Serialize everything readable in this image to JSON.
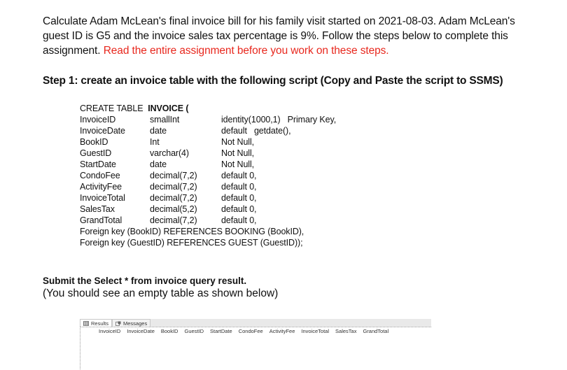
{
  "intro": {
    "line1": "Calculate Adam McLean's final invoice bill for his family visit started on 2021-08-03. Adam McLean's",
    "line2": "guest ID is G5 and the invoice sales tax percentage is 9%. Follow the steps below to complete this",
    "line3_plain": "assignment. ",
    "line3_red": "Read the entire assignment before you work on these steps."
  },
  "step1": "Step 1: create an invoice table with the following script (Copy and Paste the script to SSMS)",
  "script": {
    "header_plain": "CREATE TABLE ",
    "header_bold": "INVOICE (",
    "columns": [
      {
        "name": "InvoiceID",
        "type": "smallInt",
        "constraint": "identity(1000,1)   Primary Key,"
      },
      {
        "name": "InvoiceDate",
        "type": "date",
        "constraint": "default   getdate(),"
      },
      {
        "name": "BookID",
        "type": "Int",
        "constraint": "Not Null,"
      },
      {
        "name": "GuestID",
        "type": "varchar(4)",
        "constraint": "Not Null,"
      },
      {
        "name": "StartDate",
        "type": "date",
        "constraint": "Not Null,"
      },
      {
        "name": "CondoFee",
        "type": "decimal(7,2)",
        "constraint": "default 0,"
      },
      {
        "name": "ActivityFee",
        "type": "decimal(7,2)",
        "constraint": "default 0,"
      },
      {
        "name": "InvoiceTotal",
        "type": "decimal(7,2)",
        "constraint": "default 0,"
      },
      {
        "name": "SalesTax",
        "type": "decimal(5,2)",
        "constraint": "default 0,"
      },
      {
        "name": "GrandTotal",
        "type": "decimal(7,2)",
        "constraint": "default 0,"
      }
    ],
    "fk1": "Foreign key (BookID) REFERENCES BOOKING (BookID),",
    "fk2": "Foreign key (GuestID) REFERENCES GUEST (GuestID));"
  },
  "submit": "Submit the Select * from invoice query result.",
  "note": "(You should see an empty table as shown below)",
  "ssms": {
    "tabs": [
      {
        "label": "Results",
        "icon": "grid-icon"
      },
      {
        "label": "Messages",
        "icon": "messages-icon"
      }
    ],
    "headers": [
      "InvoiceID",
      "InvoiceDate",
      "BookID",
      "GuestID",
      "StartDate",
      "CondoFee",
      "ActivityFee",
      "InvoiceTotal",
      "SalesTax",
      "GrandTotal"
    ]
  }
}
